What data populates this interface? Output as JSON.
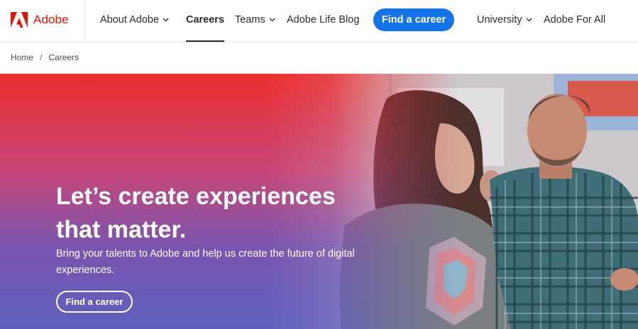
{
  "brand": {
    "name": "Adobe",
    "logo_icon": "adobe-logo-icon",
    "color": "#eb1000"
  },
  "nav": {
    "items": [
      {
        "label": "About Adobe",
        "has_dropdown": true
      },
      {
        "label": "Careers",
        "active": true
      },
      {
        "label": "Teams",
        "has_dropdown": true
      },
      {
        "label": "Adobe Life Blog"
      }
    ],
    "cta_label": "Find a career",
    "right_items": [
      {
        "label": "University",
        "has_dropdown": true
      },
      {
        "label": "Adobe For All"
      }
    ],
    "accent": "#1473e6"
  },
  "breadcrumb": {
    "items": [
      "Home",
      "Careers"
    ],
    "separator": "/"
  },
  "hero": {
    "title": "Let’s create experiences that matter.",
    "subtitle": "Bring your talents to Adobe and help us create the future of digital experiences.",
    "cta_label": "Find a career",
    "gradient_colors": [
      "#eb2d2d",
      "#c84678",
      "#7855af",
      "#5f5fbe"
    ]
  }
}
